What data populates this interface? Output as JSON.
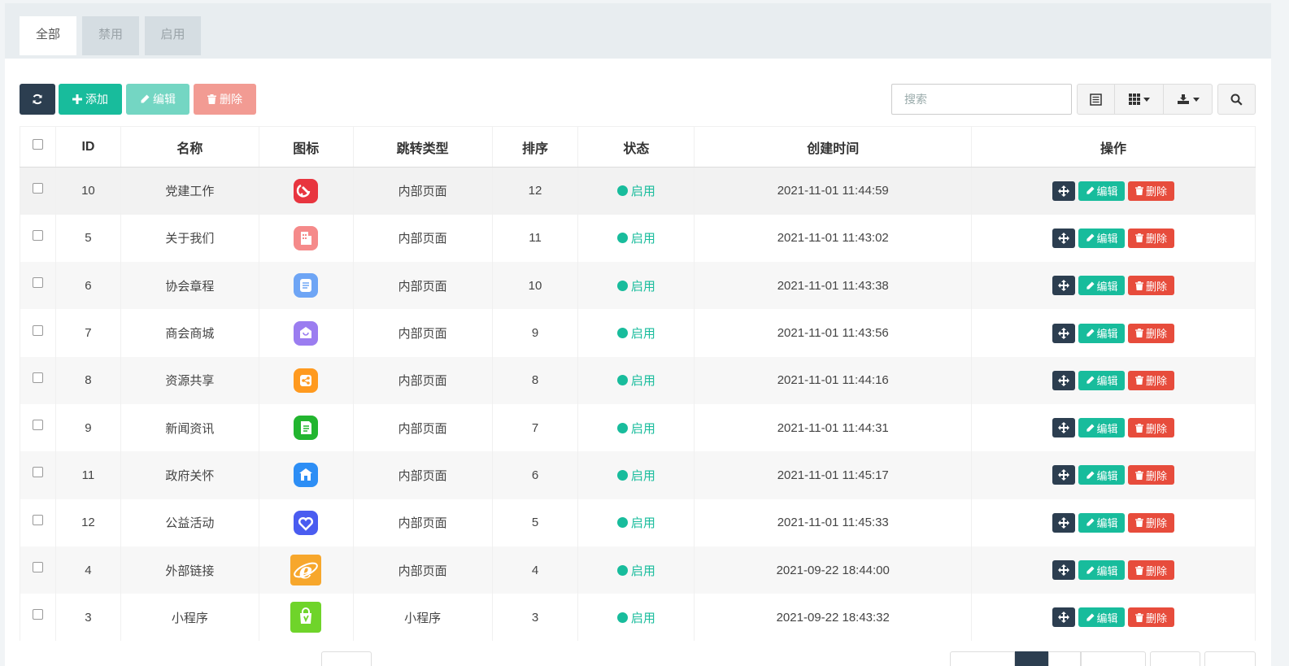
{
  "tabs": [
    {
      "label": "全部",
      "active": true
    },
    {
      "label": "禁用",
      "active": false
    },
    {
      "label": "启用",
      "active": false
    }
  ],
  "toolbar": {
    "add_label": "添加",
    "edit_label": "编辑",
    "delete_label": "删除",
    "search_placeholder": "搜索"
  },
  "columns": [
    "ID",
    "名称",
    "图标",
    "跳转类型",
    "排序",
    "状态",
    "创建时间",
    "操作"
  ],
  "row_actions": {
    "edit": "编辑",
    "delete": "删除"
  },
  "rows": [
    {
      "id": "10",
      "name": "党建工作",
      "icon": "party-icon",
      "icon_color": "#e8353f",
      "type": "内部页面",
      "sort": "12",
      "status": "启用",
      "created": "2021-11-01 11:44:59"
    },
    {
      "id": "5",
      "name": "关于我们",
      "icon": "building-icon",
      "icon_color": "#f58a8a",
      "type": "内部页面",
      "sort": "11",
      "status": "启用",
      "created": "2021-11-01 11:43:02"
    },
    {
      "id": "6",
      "name": "协会章程",
      "icon": "document-icon",
      "icon_color": "#6ea5f5",
      "type": "内部页面",
      "sort": "10",
      "status": "启用",
      "created": "2021-11-01 11:43:38"
    },
    {
      "id": "7",
      "name": "商会商城",
      "icon": "shopping-bag-icon",
      "icon_color": "#9b7df0",
      "type": "内部页面",
      "sort": "9",
      "status": "启用",
      "created": "2021-11-01 11:43:56"
    },
    {
      "id": "8",
      "name": "资源共享",
      "icon": "share-icon",
      "icon_color": "#ff9a1f",
      "type": "内部页面",
      "sort": "8",
      "status": "启用",
      "created": "2021-11-01 11:44:16"
    },
    {
      "id": "9",
      "name": "新闻资讯",
      "icon": "news-icon",
      "icon_color": "#22b52f",
      "type": "内部页面",
      "sort": "7",
      "status": "启用",
      "created": "2021-11-01 11:44:31"
    },
    {
      "id": "11",
      "name": "政府关怀",
      "icon": "government-icon",
      "icon_color": "#2d8ef5",
      "type": "内部页面",
      "sort": "6",
      "status": "启用",
      "created": "2021-11-01 11:45:17"
    },
    {
      "id": "12",
      "name": "公益活动",
      "icon": "heart-icon",
      "icon_color": "#4a5cf0",
      "type": "内部页面",
      "sort": "5",
      "status": "启用",
      "created": "2021-11-01 11:45:33"
    },
    {
      "id": "4",
      "name": "外部链接",
      "icon": "ie-browser-icon",
      "icon_color": "#f7a72c",
      "type": "内部页面",
      "sort": "4",
      "status": "启用",
      "created": "2021-09-22 18:44:00"
    },
    {
      "id": "3",
      "name": "小程序",
      "icon": "mini-program-icon",
      "icon_color": "#6fd42a",
      "type": "小程序",
      "sort": "3",
      "status": "启用",
      "created": "2021-09-22 18:43:32"
    }
  ],
  "colors": {
    "primary": "#2c3e50",
    "success": "#18bc9c",
    "danger": "#e74c3c"
  }
}
